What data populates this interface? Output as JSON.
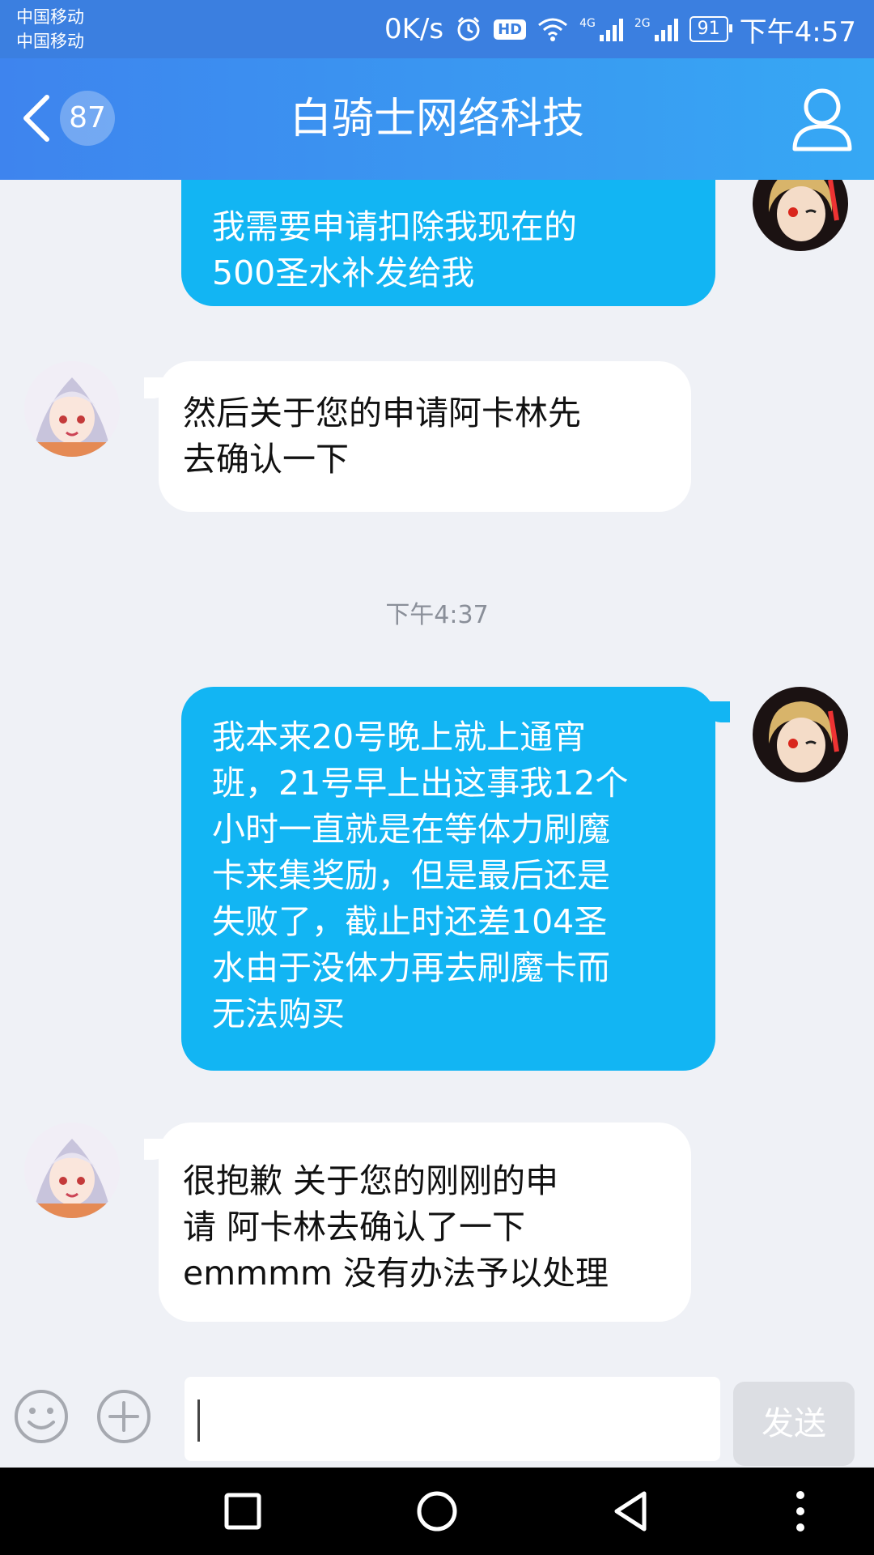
{
  "status_bar": {
    "carrier_1": "中国移动",
    "carrier_2": "中国移动",
    "net_speed": "0K/s",
    "hd_badge": "HD",
    "net_4g": "4G",
    "net_2g": "2G",
    "battery": "91",
    "time": "下午4:57"
  },
  "header": {
    "unread_count": "87",
    "title": "白骑士网络科技",
    "back_icon": "chevron-left-icon",
    "profile_icon": "person-icon"
  },
  "colors": {
    "header_start": "#3e84ee",
    "header_end": "#36a8f4",
    "outgoing_bubble": "#12b5f3",
    "incoming_bubble": "#ffffff",
    "chat_background": "#eff1f6"
  },
  "chat": {
    "messages": [
      {
        "sender": "self",
        "lines": [
          "我需要申请扣除我现在的",
          "500圣水补发给我"
        ]
      },
      {
        "sender": "other",
        "lines": [
          "然后关于您的申请阿卡林先",
          "去确认一下"
        ]
      },
      {
        "sender": "self",
        "lines": [
          "我本来20号晚上就上通宵",
          "班，21号早上出这事我12个",
          "小时一直就是在等体力刷魔",
          "卡来集奖励，但是最后还是",
          "失败了，截止时还差104圣",
          "水由于没体力再去刷魔卡而",
          "无法购买"
        ]
      },
      {
        "sender": "other",
        "lines": [
          "很抱歉 关于您的刚刚的申",
          "请 阿卡林去确认了一下",
          "emmmm 没有办法予以处理"
        ]
      }
    ],
    "timestamp": "下午4:37"
  },
  "input_bar": {
    "emoji_icon": "smiley-icon",
    "add_icon": "plus-circle-icon",
    "text_value": "",
    "send_label": "发送"
  },
  "nav_bar": {
    "recent_icon": "square-icon",
    "home_icon": "circle-icon",
    "back_icon": "triangle-back-icon",
    "menu_icon": "more-vertical-icon"
  }
}
